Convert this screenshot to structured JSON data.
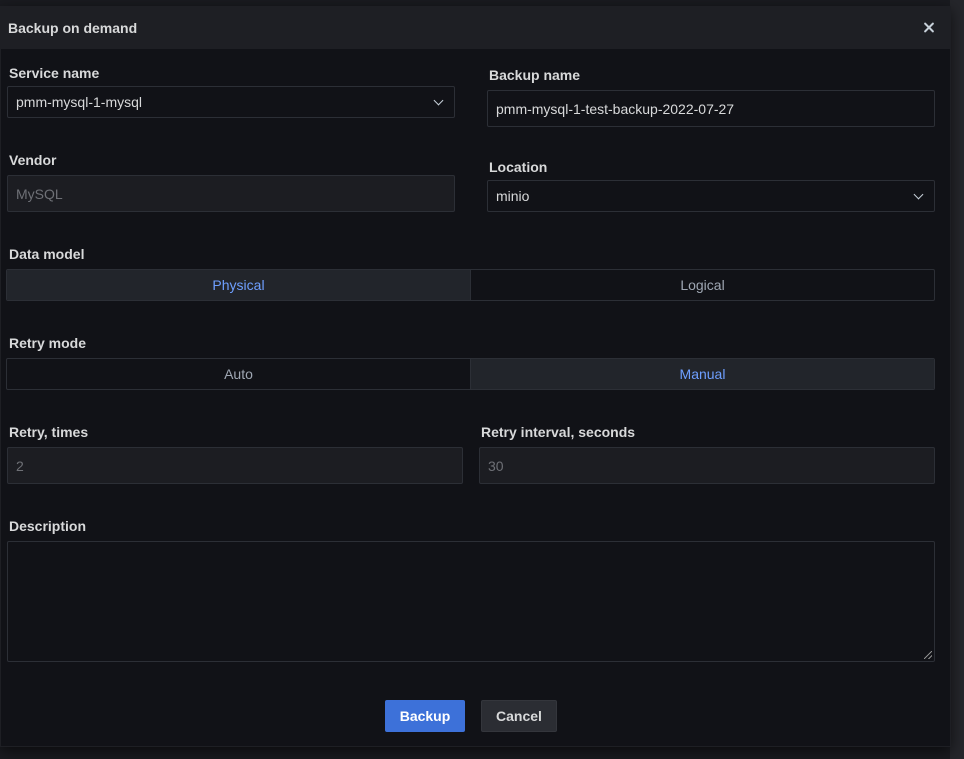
{
  "modal": {
    "title": "Backup on demand",
    "close_icon": "close-icon"
  },
  "form": {
    "service_name": {
      "label": "Service name",
      "value": "pmm-mysql-1-mysql"
    },
    "backup_name": {
      "label": "Backup name",
      "value": "pmm-mysql-1-test-backup-2022-07-27"
    },
    "vendor": {
      "label": "Vendor",
      "value": "MySQL"
    },
    "location": {
      "label": "Location",
      "value": "minio"
    },
    "data_model": {
      "label": "Data model",
      "options": [
        "Physical",
        "Logical"
      ],
      "selected": "Physical"
    },
    "retry_mode": {
      "label": "Retry mode",
      "options": [
        "Auto",
        "Manual"
      ],
      "selected": "Manual"
    },
    "retry_times": {
      "label": "Retry, times",
      "value": "2"
    },
    "retry_interval": {
      "label": "Retry interval, seconds",
      "value": "30"
    },
    "description": {
      "label": "Description",
      "value": ""
    }
  },
  "actions": {
    "backup_label": "Backup",
    "cancel_label": "Cancel"
  },
  "colors": {
    "accent": "#3d71d9",
    "active_text": "#6e9fff",
    "background": "#111217"
  }
}
